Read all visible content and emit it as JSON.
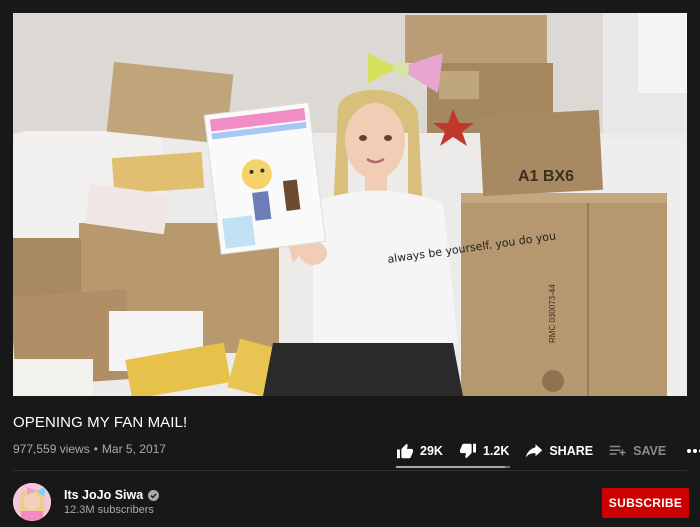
{
  "video": {
    "title": "OPENING MY FAN MAIL!",
    "views": "977,559 views",
    "date": "Mar 5, 2017",
    "shirt_text": "always be yourself. you do you",
    "box_label": "A1 BX6",
    "box_code": "RMC 030073-44"
  },
  "actions": {
    "like_count": "29K",
    "dislike_count": "1.2K",
    "share_label": "SHARE",
    "save_label": "SAVE",
    "like_ratio": 0.96
  },
  "channel": {
    "name": "Its JoJo Siwa",
    "subscribers": "12.3M subscribers",
    "subscribe_label": "SUBSCRIBE"
  },
  "icons": {
    "like": "thumbs-up-icon",
    "dislike": "thumbs-down-icon",
    "share": "share-icon",
    "save": "playlist-add-icon",
    "more": "more-icon",
    "verified": "verified-icon"
  },
  "colors": {
    "background": "#181818",
    "subscribe": "#cc0000",
    "muted_text": "#aaaaaa"
  }
}
